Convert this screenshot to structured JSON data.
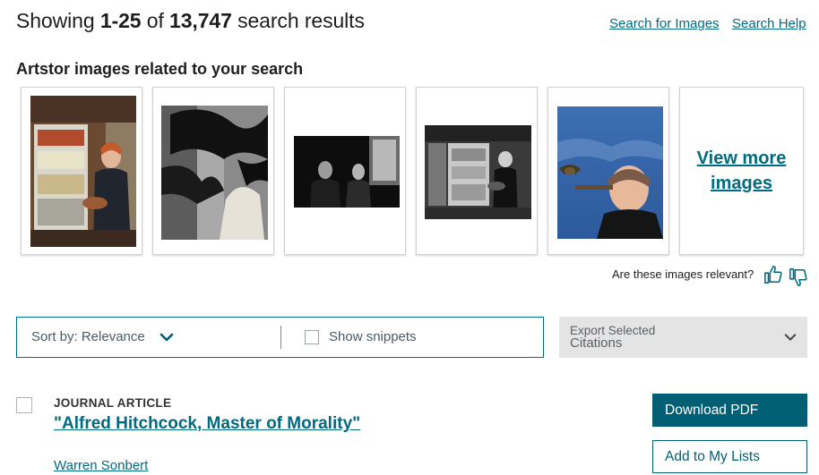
{
  "header": {
    "showing_prefix": "Showing",
    "range": "1-25",
    "of_word": "of",
    "total": "13,747",
    "suffix": "search results",
    "search_images_link": "Search for Images",
    "search_help_link": "Search Help"
  },
  "artstor": {
    "title": "Artstor images related to your search",
    "view_more": "View more images",
    "relevance_question": "Are these images relevant?",
    "thumbnails": [
      {
        "name": "woman-at-refrigerator-color"
      },
      {
        "name": "birds-attack-woman-bw"
      },
      {
        "name": "hitchcock-seated-couple-bw"
      },
      {
        "name": "woman-at-refrigerator-bw"
      },
      {
        "name": "hitchcock-cigar-bird-color"
      }
    ]
  },
  "toolbar": {
    "sort_label": "Sort by: Relevance",
    "show_snippets": "Show snippets",
    "export_line1": "Export Selected",
    "export_line2": "Citations"
  },
  "result": {
    "type": "JOURNAL ARTICLE",
    "title": "\"Alfred Hitchcock, Master of Morality\"",
    "author": "Warren Sonbert",
    "download_label": "Download PDF",
    "add_to_lists_label": "Add to My Lists"
  },
  "colors": {
    "link": "#006a80",
    "primary_button": "#005f73",
    "export_bg": "#e4e4e4"
  }
}
